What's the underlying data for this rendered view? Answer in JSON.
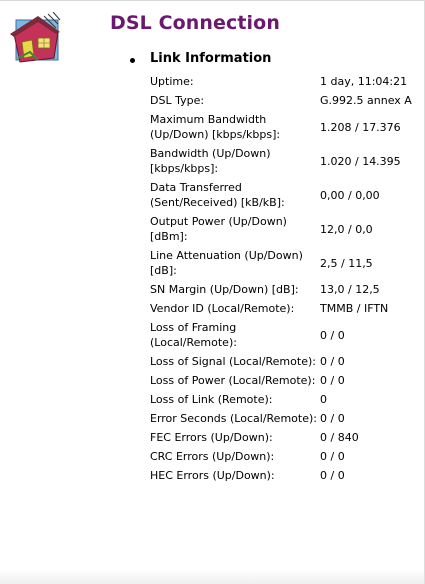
{
  "header": {
    "title": "DSL Connection",
    "logo_icon": "dsl-house-icon"
  },
  "section": {
    "title": "Link Information"
  },
  "rows": [
    {
      "label": "Uptime:",
      "value": "1 day, 11:04:21"
    },
    {
      "label": "DSL Type:",
      "value": "G.992.5 annex A"
    },
    {
      "label": "Maximum Bandwidth (Up/Down) [kbps/kbps]:",
      "value": "1.208 / 17.376"
    },
    {
      "label": "Bandwidth (Up/Down) [kbps/kbps]:",
      "value": "1.020 / 14.395"
    },
    {
      "label": "Data Transferred (Sent/Received) [kB/kB]:",
      "value": "0,00 / 0,00"
    },
    {
      "label": "Output Power (Up/Down) [dBm]:",
      "value": "12,0 / 0,0"
    },
    {
      "label": "Line Attenuation (Up/Down) [dB]:",
      "value": "2,5 / 11,5"
    },
    {
      "label": "SN Margin (Up/Down) [dB]:",
      "value": "13,0 / 12,5"
    },
    {
      "label": "Vendor ID (Local/Remote):",
      "value": "TMMB / IFTN"
    },
    {
      "label": "Loss of Framing (Local/Remote):",
      "value": "0 / 0"
    },
    {
      "label": "Loss of Signal (Local/Remote):",
      "value": "0 / 0"
    },
    {
      "label": "Loss of Power (Local/Remote):",
      "value": "0 / 0"
    },
    {
      "label": "Loss of Link (Remote):",
      "value": "0"
    },
    {
      "label": "Error Seconds (Local/Remote):",
      "value": "0 / 0"
    },
    {
      "label": "FEC Errors (Up/Down):",
      "value": "0 / 840"
    },
    {
      "label": "CRC Errors (Up/Down):",
      "value": "0 / 0"
    },
    {
      "label": "HEC Errors (Up/Down):",
      "value": "0 / 0"
    }
  ],
  "colors": {
    "title": "#6a1870",
    "text": "#000000"
  }
}
